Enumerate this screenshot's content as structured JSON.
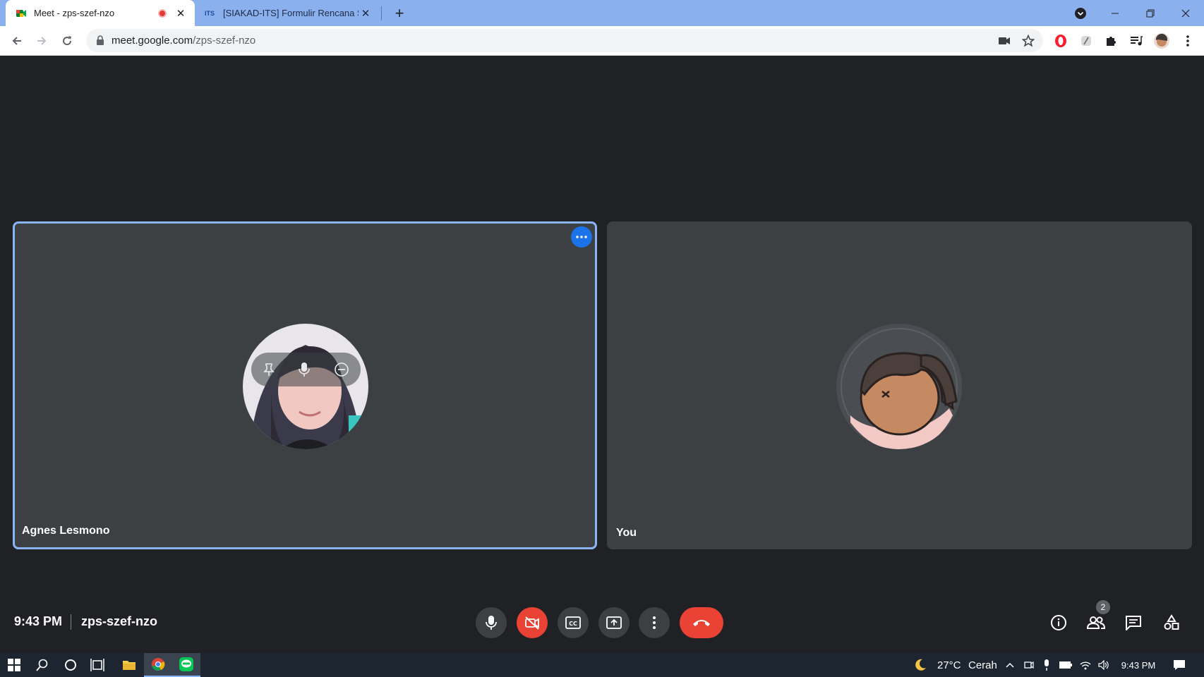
{
  "browser": {
    "tabs": [
      {
        "title": "Meet - zps-szef-nzo",
        "active": true,
        "recording": true
      },
      {
        "title": "[SIAKAD-ITS] Formulir Rencana St",
        "active": false,
        "favicon_text": "ITS"
      }
    ],
    "url_host": "meet.google.com",
    "url_path": "/zps-szef-nzo",
    "colors": {
      "tabstrip": "#8ab0ee",
      "accent": "#1a73e8"
    }
  },
  "meeting": {
    "participants": [
      {
        "name": "Agnes Lesmono",
        "active_speaker": true
      },
      {
        "name": "You",
        "active_speaker": false
      }
    ],
    "time": "9:43 PM",
    "code": "zps-szef-nzo",
    "people_count": "2"
  },
  "taskbar": {
    "weather_temp": "27°C",
    "weather_text": "Cerah",
    "clock": "9:43 PM"
  }
}
